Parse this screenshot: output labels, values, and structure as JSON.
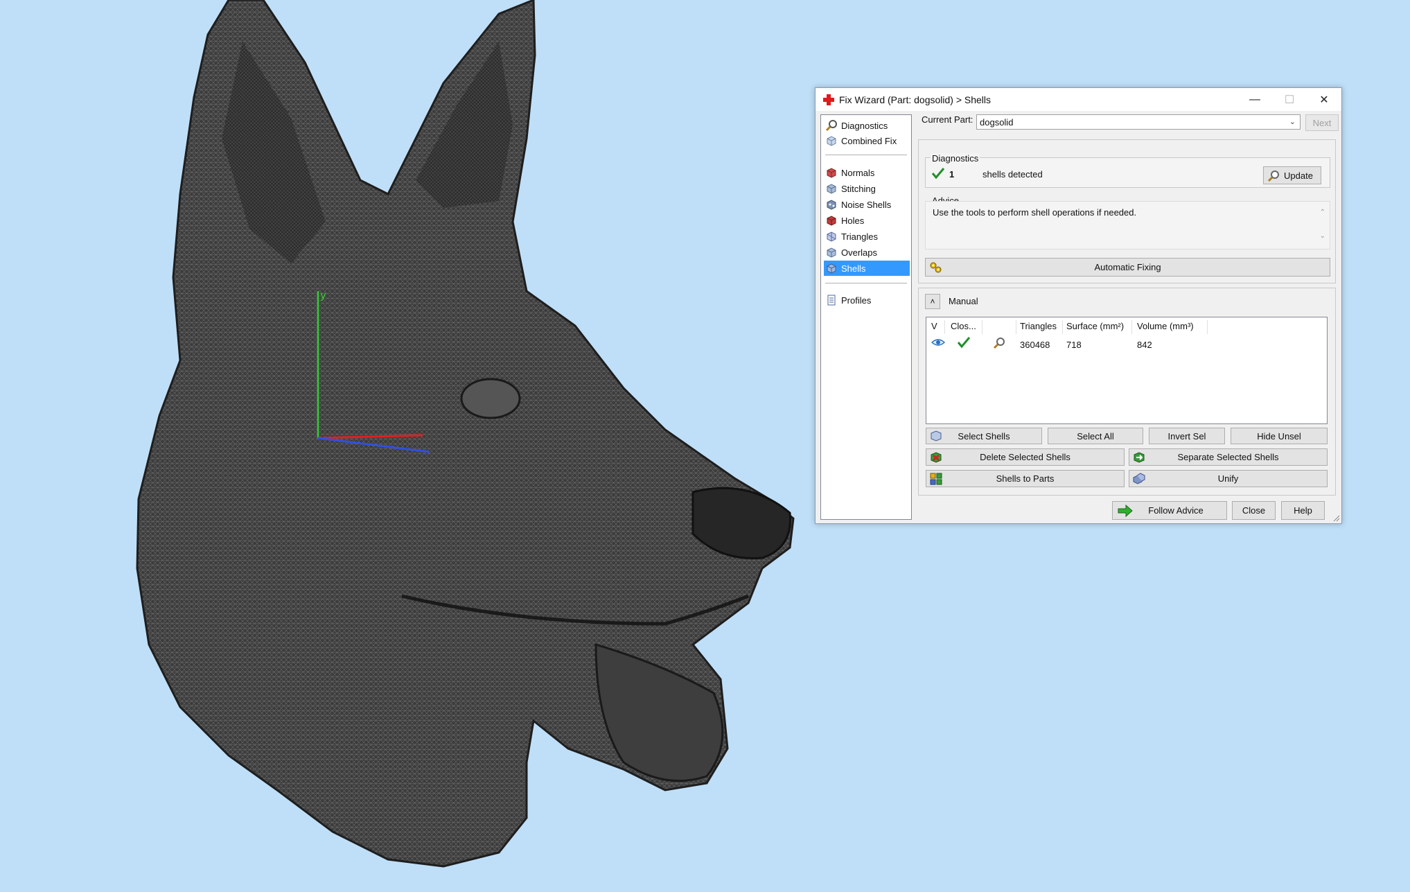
{
  "window": {
    "title": "Fix Wizard (Part: dogsolid) > Shells",
    "minimize_icon": "minimize-icon",
    "maximize_icon": "maximize-icon",
    "close_icon": "close-icon"
  },
  "viewport": {
    "axis_y_label": "y",
    "axis_colors": {
      "y": "#33cc33",
      "x": "#e02020",
      "z": "#3050e0"
    },
    "model_color": "#4a4a4a",
    "background": "#bfdff8"
  },
  "nav": {
    "items": [
      {
        "label": "Diagnostics",
        "icon": "magnifier-icon"
      },
      {
        "label": "Combined Fix",
        "icon": "cube-icon"
      },
      {
        "label": "Normals",
        "icon": "cube-icon"
      },
      {
        "label": "Stitching",
        "icon": "cube-icon"
      },
      {
        "label": "Noise Shells",
        "icon": "cube-icon"
      },
      {
        "label": "Holes",
        "icon": "cube-icon"
      },
      {
        "label": "Triangles",
        "icon": "cube-icon"
      },
      {
        "label": "Overlaps",
        "icon": "cube-icon"
      },
      {
        "label": "Shells",
        "icon": "cube-icon",
        "selected": true
      },
      {
        "label": "Profiles",
        "icon": "document-icon"
      }
    ]
  },
  "current_part": {
    "label": "Current Part:",
    "value": "dogsolid",
    "next_label": "Next"
  },
  "diagnostics": {
    "group_label": "Diagnostics",
    "count": "1",
    "status_text": "shells detected",
    "update_label": "Update"
  },
  "advice": {
    "group_label": "Advice",
    "text": "Use the tools to perform shell operations if needed."
  },
  "automatic_fixing_label": "Automatic Fixing",
  "manual": {
    "label": "Manual",
    "table": {
      "columns": [
        "V",
        "Clos...",
        "",
        "Triangles",
        "Surface (mm²)",
        "Volume (mm³)"
      ],
      "rows": [
        {
          "visible_icon": "eye-icon",
          "closed_icon": "checkmark-icon",
          "action_icon": "magnifier-icon",
          "triangles": "360468",
          "surface": "718",
          "volume": "842"
        }
      ]
    },
    "buttons": {
      "select_shells": "Select Shells",
      "select_all": "Select All",
      "invert_sel": "Invert Sel",
      "hide_unsel": "Hide Unsel",
      "delete_selected": "Delete Selected Shells",
      "separate_selected": "Separate Selected Shells",
      "shells_to_parts": "Shells to Parts",
      "unify": "Unify"
    }
  },
  "footer": {
    "follow_advice": "Follow Advice",
    "close": "Close",
    "help": "Help"
  }
}
